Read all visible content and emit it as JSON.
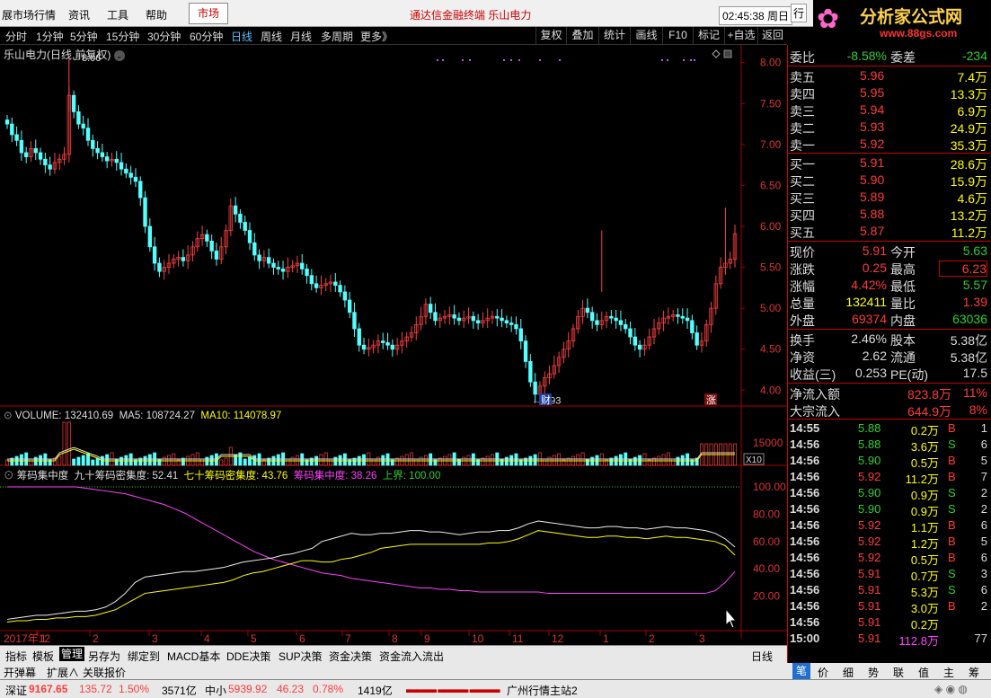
{
  "menubar": {
    "items": [
      "展市场行情",
      "资讯",
      "工具",
      "帮助"
    ],
    "market_tab": "市场",
    "title": "通达信金融终端  乐山电力",
    "clock": "02:45:38 周日",
    "row_btn": "行"
  },
  "logo": {
    "name": "分析家公式网",
    "url": "www.88gs.com"
  },
  "toolbar": {
    "periods": [
      "分时",
      "1分钟",
      "5分钟",
      "15分钟",
      "30分钟",
      "60分钟",
      "日线",
      "周线",
      "月线",
      "多周期",
      "更多》"
    ],
    "active": "日线",
    "right_buttons": [
      "复权",
      "叠加",
      "统计",
      "画线",
      "F10",
      "标记",
      "+自选",
      "返回"
    ]
  },
  "chart_title": "乐山电力(日线,前复权)",
  "chart_data": {
    "type": "candlestick",
    "price_axis": [
      8.0,
      7.5,
      7.0,
      6.5,
      6.0,
      5.5,
      5.0,
      4.5,
      4.0
    ],
    "high_label": "8.06",
    "low_label": "3.93",
    "marks": [
      "财",
      "涨"
    ],
    "x_labels": [
      "2017年12",
      "1",
      "2",
      "3",
      "4",
      "5",
      "6",
      "7",
      "8",
      "9",
      "10",
      "11",
      "12",
      "1",
      "2",
      "3"
    ],
    "closes": [
      7.25,
      7.12,
      7.05,
      6.9,
      6.85,
      6.95,
      6.9,
      6.82,
      6.75,
      6.7,
      6.78,
      6.82,
      6.88,
      7.6,
      7.4,
      7.25,
      7.2,
      7.05,
      6.95,
      6.9,
      6.85,
      6.8,
      6.82,
      6.78,
      6.7,
      6.65,
      6.6,
      6.55,
      6.35,
      6.0,
      5.75,
      5.55,
      5.45,
      5.5,
      5.55,
      5.6,
      5.62,
      5.58,
      5.65,
      5.75,
      5.85,
      5.9,
      5.82,
      5.7,
      5.6,
      5.75,
      5.95,
      6.25,
      6.15,
      6.05,
      5.95,
      5.8,
      5.65,
      5.58,
      5.62,
      5.55,
      5.5,
      5.48,
      5.45,
      5.5,
      5.52,
      5.55,
      5.48,
      5.4,
      5.3,
      5.25,
      5.28,
      5.3,
      5.32,
      5.28,
      5.2,
      5.1,
      4.95,
      4.75,
      4.55,
      4.5,
      4.52,
      4.55,
      4.6,
      4.58,
      4.55,
      4.5,
      4.55,
      4.6,
      4.65,
      4.7,
      4.8,
      4.9,
      5.05,
      4.95,
      4.85,
      4.88,
      4.9,
      4.92,
      4.88,
      4.85,
      4.88,
      4.9,
      4.85,
      4.82,
      4.85,
      4.88,
      4.9,
      4.88,
      4.85,
      4.82,
      4.8,
      4.75,
      4.6,
      4.35,
      4.1,
      3.95,
      4.05,
      4.15,
      4.2,
      4.3,
      4.4,
      4.5,
      4.6,
      4.75,
      4.9,
      5.0,
      4.95,
      4.85,
      4.8,
      4.85,
      4.9,
      4.88,
      4.85,
      4.8,
      4.75,
      4.65,
      4.55,
      4.5,
      4.55,
      4.65,
      4.75,
      4.82,
      4.88,
      4.9,
      4.92,
      4.9,
      4.88,
      4.85,
      4.7,
      4.55,
      4.6,
      4.8,
      5.0,
      5.3,
      5.5,
      5.55,
      5.6,
      5.91
    ],
    "volume": {
      "label": "VOLUME: 132410.69",
      "ma5": "MA5: 108724.27",
      "ma10": "MA10: 114078.97",
      "axis": "15000",
      "unit": "X10"
    },
    "chip": {
      "label": "筹码集中度",
      "s90": "九十筹码密集度: 52.41",
      "s70": "七十筹码密集度: 43.76",
      "conc": "筹码集中度: 38.26",
      "upper": "上界: 100.00",
      "axis": [
        100.0,
        80.0,
        60.0,
        40.0,
        20.0
      ],
      "series90": [
        3,
        4,
        5,
        6,
        6,
        7,
        8,
        9,
        9,
        10,
        12,
        16,
        22,
        30,
        34,
        35,
        36,
        37,
        38,
        38,
        39,
        40,
        41,
        43,
        45,
        46,
        47,
        48,
        50,
        51,
        53,
        55,
        60,
        62,
        64,
        66,
        65,
        65,
        66,
        66,
        67,
        68,
        68,
        67,
        67,
        66,
        65,
        66,
        67,
        67,
        68,
        68,
        70,
        73,
        75,
        74,
        73,
        72,
        71,
        70,
        70,
        71,
        71,
        70,
        70,
        69,
        70,
        71,
        70,
        70,
        69,
        68,
        66,
        62,
        56
      ],
      "series70": [
        1,
        2,
        2,
        3,
        3,
        4,
        4,
        5,
        5,
        6,
        8,
        10,
        14,
        18,
        22,
        23,
        24,
        25,
        26,
        27,
        28,
        29,
        30,
        32,
        35,
        37,
        38,
        40,
        42,
        44,
        46,
        46,
        45,
        45,
        47,
        48,
        50,
        52,
        55,
        56,
        57,
        58,
        58,
        58,
        58,
        58,
        58,
        58,
        58,
        59,
        59,
        60,
        62,
        65,
        68,
        67,
        66,
        65,
        64,
        63,
        63,
        64,
        64,
        63,
        63,
        62,
        63,
        64,
        63,
        63,
        62,
        61,
        60,
        57,
        50
      ],
      "series_conc": [
        100,
        100,
        100,
        100,
        100,
        100,
        100,
        100,
        99,
        98,
        97,
        96,
        95,
        93,
        91,
        89,
        87,
        84,
        81,
        77,
        73,
        69,
        65,
        61,
        57,
        53,
        50,
        47,
        45,
        43,
        41,
        39,
        37,
        36,
        35,
        33,
        32,
        31,
        30,
        29,
        28,
        27,
        26,
        26,
        25,
        25,
        24,
        24,
        23,
        23,
        23,
        23,
        23,
        23,
        23,
        22,
        22,
        22,
        22,
        22,
        22,
        22,
        22,
        22,
        22,
        22,
        22,
        22,
        22,
        22,
        22,
        22,
        24,
        30,
        38
      ]
    }
  },
  "right_panel": {
    "ratio": [
      {
        "k": "委比",
        "v": "-8.58%"
      },
      {
        "k": "委差",
        "v": "-234"
      }
    ],
    "asks": [
      {
        "k": "卖五",
        "p": "5.96",
        "v": "7.4万"
      },
      {
        "k": "卖四",
        "p": "5.95",
        "v": "13.3万"
      },
      {
        "k": "卖三",
        "p": "5.94",
        "v": "6.9万"
      },
      {
        "k": "卖二",
        "p": "5.93",
        "v": "24.9万"
      },
      {
        "k": "卖一",
        "p": "5.92",
        "v": "35.3万"
      }
    ],
    "bids": [
      {
        "k": "买一",
        "p": "5.91",
        "v": "28.6万"
      },
      {
        "k": "买二",
        "p": "5.90",
        "v": "15.9万"
      },
      {
        "k": "买三",
        "p": "5.89",
        "v": "4.6万"
      },
      {
        "k": "买四",
        "p": "5.88",
        "v": "13.2万"
      },
      {
        "k": "买五",
        "p": "5.87",
        "v": "11.2万"
      }
    ],
    "stats": [
      {
        "k1": "现价",
        "v1": "5.91",
        "k2": "今开",
        "v2": "5.63"
      },
      {
        "k1": "涨跌",
        "v1": "0.25",
        "k2": "最高",
        "v2": "6.23"
      },
      {
        "k1": "涨幅",
        "v1": "4.42%",
        "k2": "最低",
        "v2": "5.57"
      },
      {
        "k1": "总量",
        "v1": "132411",
        "k2": "量比",
        "v2": "1.39"
      },
      {
        "k1": "外盘",
        "v1": "69374",
        "k2": "内盘",
        "v2": "63036"
      }
    ],
    "stats2": [
      {
        "k1": "换手",
        "v1": "2.46%",
        "k2": "股本",
        "v2": "5.38亿"
      },
      {
        "k1": "净资",
        "v1": "2.62",
        "k2": "流通",
        "v2": "5.38亿"
      },
      {
        "k1": "收益(三)",
        "v1": "0.253",
        "k2": "PE(动)",
        "v2": "17.5"
      }
    ],
    "flows": [
      {
        "k": "净流入额",
        "v": "823.8万",
        "p": "11%"
      },
      {
        "k": "大宗流入",
        "v": "644.9万",
        "p": "8%"
      }
    ],
    "ticks": [
      {
        "t": "14:55",
        "p": "5.88",
        "v": "0.2万",
        "d": "B",
        "n": "1"
      },
      {
        "t": "14:56",
        "p": "5.88",
        "v": "3.6万",
        "d": "S",
        "n": "6"
      },
      {
        "t": "14:56",
        "p": "5.90",
        "v": "0.5万",
        "d": "B",
        "n": "5"
      },
      {
        "t": "14:56",
        "p": "5.92",
        "v": "11.2万",
        "d": "B",
        "n": "7"
      },
      {
        "t": "14:56",
        "p": "5.90",
        "v": "0.9万",
        "d": "S",
        "n": "2"
      },
      {
        "t": "14:56",
        "p": "5.90",
        "v": "0.9万",
        "d": "S",
        "n": "2"
      },
      {
        "t": "14:56",
        "p": "5.92",
        "v": "1.1万",
        "d": "B",
        "n": "6"
      },
      {
        "t": "14:56",
        "p": "5.92",
        "v": "1.2万",
        "d": "B",
        "n": "5"
      },
      {
        "t": "14:56",
        "p": "5.92",
        "v": "0.5万",
        "d": "B",
        "n": "6"
      },
      {
        "t": "14:56",
        "p": "5.91",
        "v": "0.7万",
        "d": "S",
        "n": "3"
      },
      {
        "t": "14:56",
        "p": "5.91",
        "v": "5.3万",
        "d": "S",
        "n": "6"
      },
      {
        "t": "14:56",
        "p": "5.91",
        "v": "3.0万",
        "d": "B",
        "n": "2"
      },
      {
        "t": "14:56",
        "p": "5.91",
        "v": "0.2万",
        "d": "",
        "n": ""
      },
      {
        "t": "15:00",
        "p": "5.91",
        "v": "112.8万",
        "d": "",
        "n": "77"
      }
    ],
    "tabs": [
      "笔",
      "价",
      "细",
      "势",
      "联",
      "值",
      "主",
      "筹"
    ]
  },
  "bottombar": {
    "tabs": [
      "指标",
      "模板",
      "管理",
      "另存为",
      "绑定到",
      "MACD基本",
      "DDE决策",
      "SUP决策",
      "资金决策",
      "资金流入流出"
    ],
    "active": "管理",
    "right": [
      "日线",
      "+",
      "−"
    ]
  },
  "subbar": [
    "开弹幕",
    "扩展∧",
    "关联报价"
  ],
  "statusbar": {
    "sz_label": "深证",
    "sz_val": "9167.65",
    "sz_chg": "135.72",
    "sz_pct": "1.50%",
    "sz_amt": "3571亿",
    "zx_label": "中小",
    "zx_val": "5939.92",
    "zx_chg": "46.23",
    "zx_pct": "0.78%",
    "zx_amt": "1419亿",
    "server": "广州行情主站2"
  }
}
